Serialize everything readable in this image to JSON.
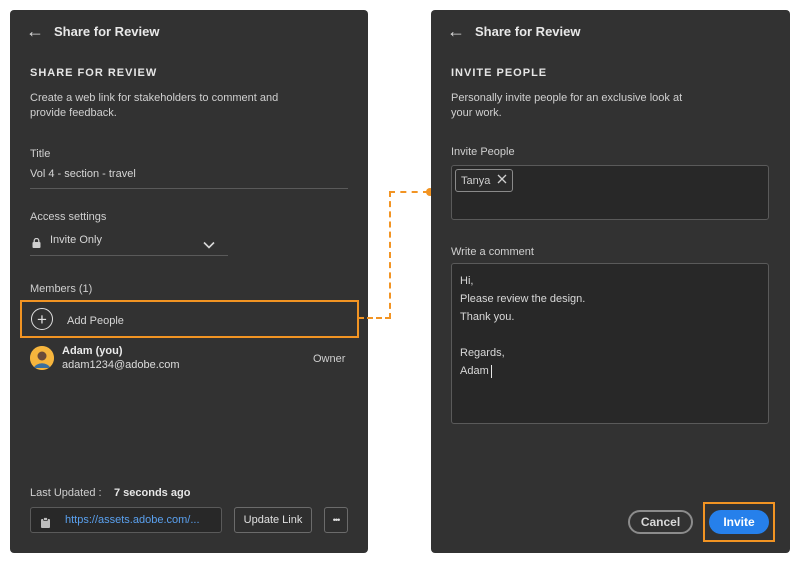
{
  "left": {
    "header_title": "Share for Review",
    "section_title": "SHARE FOR REVIEW",
    "description": "Create a web link for stakeholders to comment and provide feedback.",
    "title_label": "Title",
    "title_value": "Vol 4 - section - travel",
    "access_label": "Access settings",
    "access_value": "Invite Only",
    "members_label": "Members (1)",
    "add_people_label": "Add People",
    "member": {
      "name": "Adam (you)",
      "email": "adam1234@adobe.com",
      "role": "Owner"
    },
    "last_updated_label": "Last Updated :",
    "last_updated_value": "7 seconds ago",
    "link_url": "https://assets.adobe.com/...",
    "update_link_label": "Update Link",
    "more_label": "•••"
  },
  "right": {
    "header_title": "Share for Review",
    "section_title": "INVITE PEOPLE",
    "description": "Personally invite people for an exclusive look at your work.",
    "invite_label": "Invite People",
    "tags": [
      "Tanya"
    ],
    "comment_label": "Write a comment",
    "comment_text": "Hi,\nPlease review the design.\nThank you.\n\nRegards,\nAdam",
    "cancel_label": "Cancel",
    "invite_button_label": "Invite"
  },
  "colors": {
    "panel_bg": "#323232",
    "highlight": "#f29423",
    "accent": "#2680eb",
    "link": "#5aa0ee"
  },
  "icons": {
    "back": "←",
    "plus": "+",
    "chevron": "chevron-down",
    "lock": "lock",
    "clipboard": "clipboard",
    "close": "×"
  }
}
